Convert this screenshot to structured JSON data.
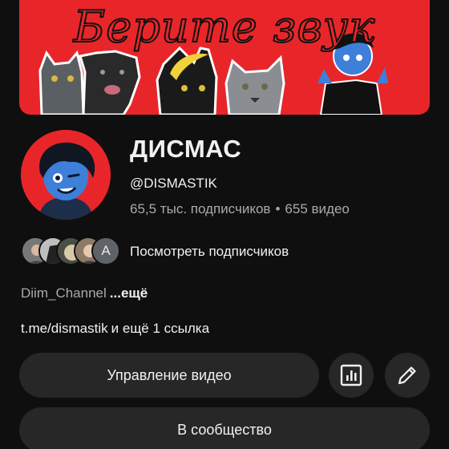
{
  "banner": {
    "title": "Берите звук",
    "background_color": "#e8262a"
  },
  "channel": {
    "name": "ДИСМАС",
    "handle": "@DISMASTIK",
    "subscribers": "65,5 тыс. подписчиков",
    "separator": "•",
    "videos": "655 видео",
    "avatar_background": "#e8262a"
  },
  "subscribers_preview": {
    "letter_avatar": "A",
    "link_label": "Посмотреть подписчиков"
  },
  "description": {
    "text": "Diim_Channel",
    "more_label": "...ещё"
  },
  "links": {
    "url": "t.me/dismastik",
    "extra": "и ещё 1 ссылка"
  },
  "actions": {
    "manage_videos_label": "Управление видео",
    "analytics_icon": "analytics-icon",
    "edit_icon": "pencil-icon",
    "community_label": "В сообщество"
  }
}
